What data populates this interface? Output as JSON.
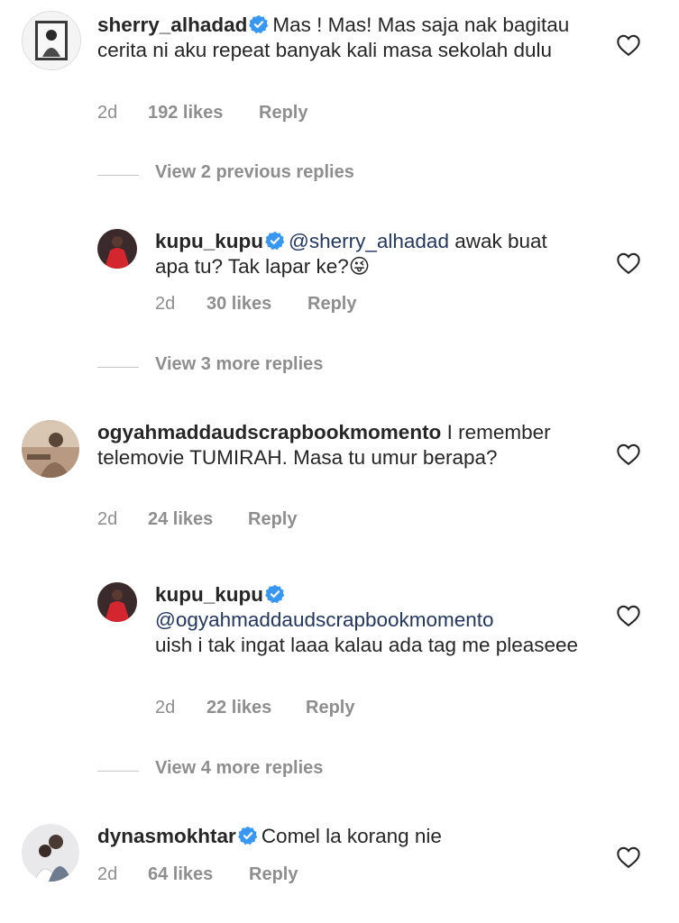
{
  "comments": [
    {
      "username": "sherry_alhadad",
      "verified": true,
      "text": "Mas ! Mas! Mas saja nak bagitau cerita ni aku repeat banyak kali masa sekolah dulu",
      "time": "2d",
      "likes": "192 likes",
      "reply": "Reply"
    },
    {
      "username": "kupu_kupu",
      "verified": true,
      "mention": "@sherry_alhadad",
      "text": "awak buat apa tu? Tak lapar ke?",
      "emoji": "😜",
      "time": "2d",
      "likes": "30 likes",
      "reply": "Reply"
    },
    {
      "username": "ogyahmaddaudscrapbookmomento",
      "verified": false,
      "text": "I remember telemovie TUMIRAH. Masa tu umur berapa?",
      "time": "2d",
      "likes": "24 likes",
      "reply": "Reply"
    },
    {
      "username": "kupu_kupu",
      "verified": true,
      "mention": "@ogyahmaddaudscrapbookmomento",
      "text": "uish i tak ingat laaa kalau ada tag me pleaseee",
      "time": "2d",
      "likes": "22 likes",
      "reply": "Reply"
    },
    {
      "username": "dynasmokhtar",
      "verified": true,
      "text": "Comel la korang nie",
      "time": "2d",
      "likes": "64 likes",
      "reply": "Reply"
    }
  ],
  "view_replies": [
    "View 2 previous replies",
    "View 3 more replies",
    "View 4 more replies"
  ],
  "colors": {
    "verified": "#3897f0",
    "mention": "#23375f",
    "muted": "#8e8e8e"
  },
  "icons": {
    "like": "heart-outline-icon",
    "verified": "verified-badge-icon"
  }
}
